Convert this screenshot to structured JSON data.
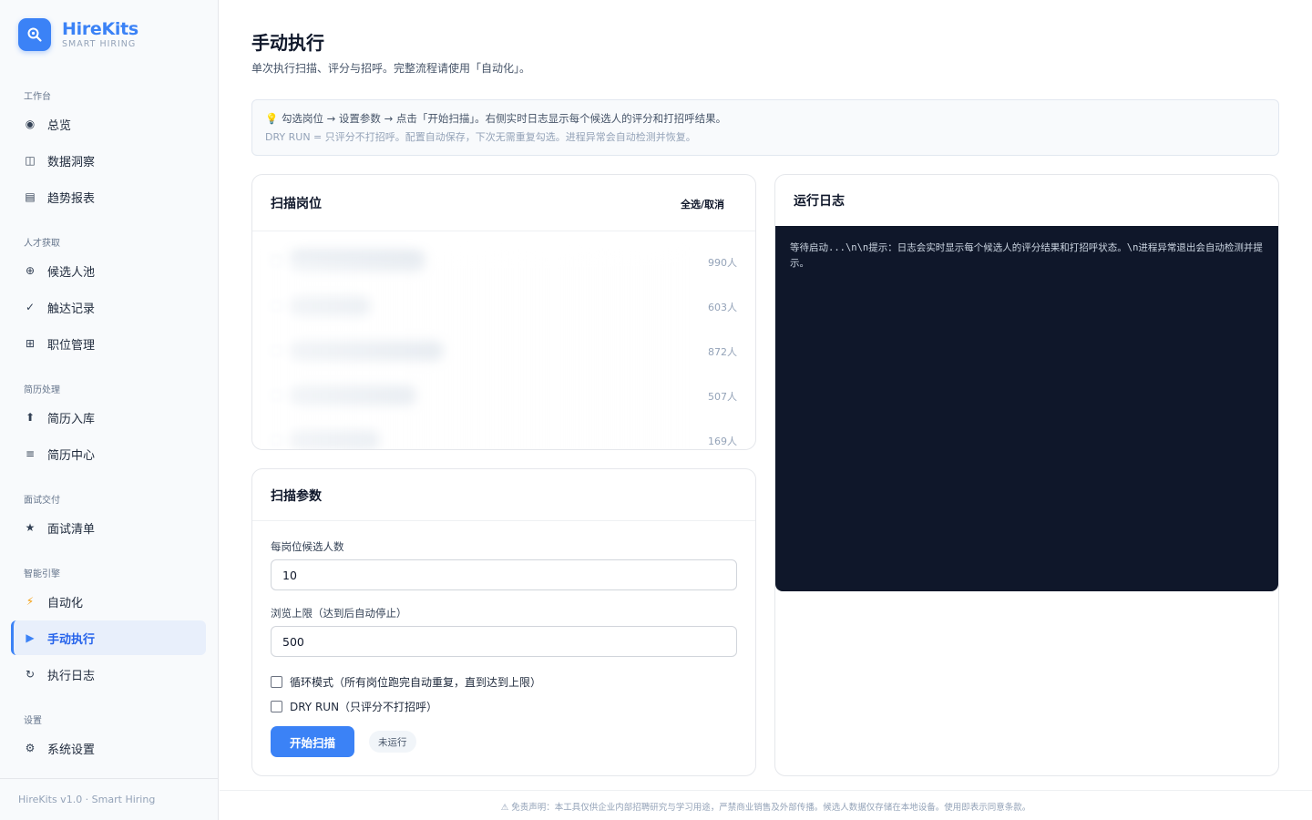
{
  "brand": {
    "name": "HireKits",
    "subtitle": "SMART HIRING"
  },
  "sidebar": {
    "sections": [
      {
        "title": "工作台",
        "items": [
          {
            "label": "总览",
            "icon": "dashboard-icon"
          },
          {
            "label": "数据洞察",
            "icon": "insight-icon"
          },
          {
            "label": "趋势报表",
            "icon": "report-icon"
          }
        ]
      },
      {
        "title": "人才获取",
        "items": [
          {
            "label": "候选人池",
            "icon": "pool-icon"
          },
          {
            "label": "触达记录",
            "icon": "check-icon"
          },
          {
            "label": "职位管理",
            "icon": "grid-icon"
          }
        ]
      },
      {
        "title": "简历处理",
        "items": [
          {
            "label": "简历入库",
            "icon": "upload-icon"
          },
          {
            "label": "简历中心",
            "icon": "list-icon"
          }
        ]
      },
      {
        "title": "面试交付",
        "items": [
          {
            "label": "面试清单",
            "icon": "star-icon"
          }
        ]
      },
      {
        "title": "智能引擎",
        "items": [
          {
            "label": "自动化",
            "icon": "bolt-icon"
          },
          {
            "label": "手动执行",
            "icon": "play-icon",
            "active": true
          },
          {
            "label": "执行日志",
            "icon": "refresh-icon"
          }
        ]
      },
      {
        "title": "设置",
        "items": [
          {
            "label": "系统设置",
            "icon": "gear-icon"
          }
        ]
      }
    ],
    "footer": "HireKits v1.0 · Smart Hiring"
  },
  "page": {
    "title": "手动执行",
    "subtitle": "单次执行扫描、评分与招呼。完整流程请使用「自动化」。"
  },
  "tip": {
    "icon": "lightbulb-icon",
    "line1": "勾选岗位 → 设置参数 → 点击「开始扫描」。右侧实时日志显示每个候选人的评分和打招呼结果。",
    "line2": "DRY RUN = 只评分不打招呼。配置自动保存，下次无需重复勾选。进程异常会自动检测并恢复。"
  },
  "jobs": {
    "title": "扫描岗位",
    "toggle_all": "全选/取消",
    "rows": [
      {
        "name": "████████",
        "count": "990人"
      },
      {
        "name": "████",
        "count": "603人"
      },
      {
        "name": "██████████",
        "count": "872人"
      },
      {
        "name": "███████",
        "count": "507人"
      },
      {
        "name": "█████",
        "count": "169人"
      }
    ]
  },
  "params": {
    "title": "扫描参数",
    "per_job_label": "每岗位候选人数",
    "per_job_value": "10",
    "browse_limit_label": "浏览上限（达到后自动停止）",
    "browse_limit_value": "500",
    "loop_mode_label": "循环模式（所有岗位跑完自动重复，直到达到上限）",
    "dry_run_label": "DRY RUN（只评分不打招呼）",
    "start_button": "开始扫描",
    "status": "未运行"
  },
  "log": {
    "title": "运行日志",
    "content": "等待启动...\\n\\n提示：日志会实时显示每个候选人的评分结果和打招呼状态。\\n进程异常退出会自动检测并提示。"
  },
  "disclaimer": "⚠ 免责声明：本工具仅供企业内部招聘研究与学习用途，严禁商业销售及外部传播。候选人数据仅存储在本地设备。使用即表示同意条款。",
  "colors": {
    "accent": "#3b82f6",
    "log_bg": "#0f172a",
    "sidebar_bg": "#f8fafc"
  }
}
